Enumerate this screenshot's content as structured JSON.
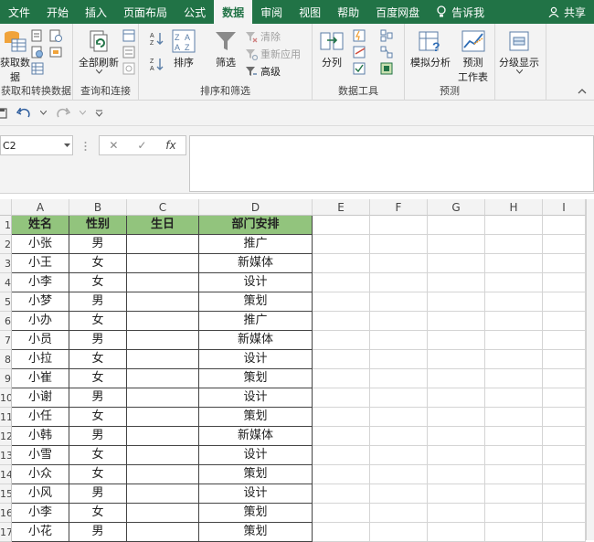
{
  "tabs": [
    {
      "label": "文件",
      "active": false
    },
    {
      "label": "开始",
      "active": false
    },
    {
      "label": "插入",
      "active": false
    },
    {
      "label": "页面布局",
      "active": false
    },
    {
      "label": "公式",
      "active": false
    },
    {
      "label": "数据",
      "active": true
    },
    {
      "label": "审阅",
      "active": false
    },
    {
      "label": "视图",
      "active": false
    },
    {
      "label": "帮助",
      "active": false
    },
    {
      "label": "百度网盘",
      "active": false
    }
  ],
  "tell_me": "告诉我",
  "share": "共享",
  "ribbon": {
    "get_data_label": "获取数",
    "get_data_label2": "据",
    "group1_label": "获取和转换数据",
    "refresh_all": "全部刷新",
    "group2_label": "查询和连接",
    "sort": "排序",
    "filter": "筛选",
    "clear": "清除",
    "reapply": "重新应用",
    "advanced": "高级",
    "group3_label": "排序和筛选",
    "split": "分列",
    "group4_label": "数据工具",
    "whatif": "模拟分析",
    "forecast_sheet": "预测",
    "forecast_sheet2": "工作表",
    "group5_label": "预测",
    "outline": "分级显示"
  },
  "namebox": "C2",
  "formula_value": "",
  "fx": "fx",
  "columns": [
    "A",
    "B",
    "C",
    "D",
    "E",
    "F",
    "G",
    "H",
    "I"
  ],
  "header_row": [
    "姓名",
    "性别",
    "生日",
    "部门安排"
  ],
  "rows": [
    [
      "小张",
      "男",
      "",
      "推广"
    ],
    [
      "小王",
      "女",
      "",
      "新媒体"
    ],
    [
      "小李",
      "女",
      "",
      "设计"
    ],
    [
      "小梦",
      "男",
      "",
      "策划"
    ],
    [
      "小办",
      "女",
      "",
      "推广"
    ],
    [
      "小员",
      "男",
      "",
      "新媒体"
    ],
    [
      "小拉",
      "女",
      "",
      "设计"
    ],
    [
      "小崔",
      "女",
      "",
      "策划"
    ],
    [
      "小谢",
      "男",
      "",
      "设计"
    ],
    [
      "小任",
      "女",
      "",
      "策划"
    ],
    [
      "小韩",
      "男",
      "",
      "新媒体"
    ],
    [
      "小雪",
      "女",
      "",
      "设计"
    ],
    [
      "小众",
      "女",
      "",
      "策划"
    ],
    [
      "小风",
      "男",
      "",
      "设计"
    ],
    [
      "小李",
      "女",
      "",
      "策划"
    ],
    [
      "小花",
      "男",
      "",
      "策划"
    ]
  ],
  "row_numbers": [
    "1",
    "2",
    "3",
    "4",
    "5",
    "6",
    "7",
    "8",
    "9",
    "10",
    "11",
    "12",
    "13",
    "14",
    "15",
    "16",
    "17"
  ],
  "colors": {
    "accent": "#217346",
    "header_fill": "#92c47d"
  }
}
